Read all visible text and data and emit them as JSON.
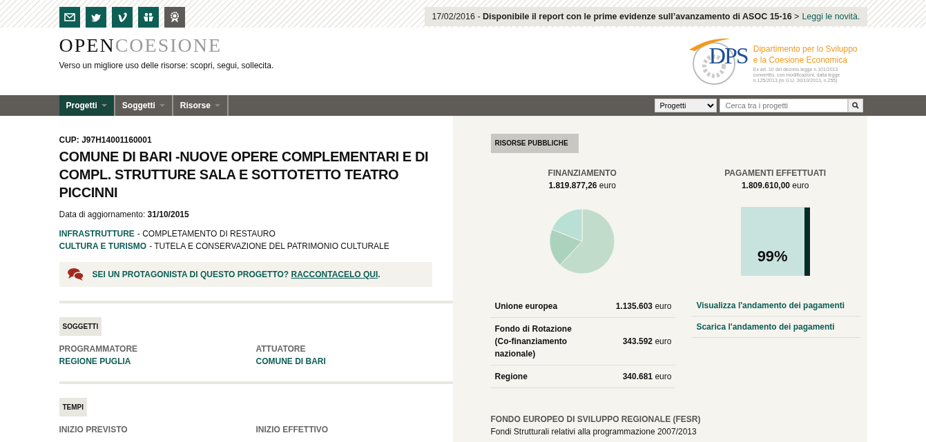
{
  "social_links": [
    {
      "kind": "mail"
    },
    {
      "kind": "bird"
    },
    {
      "kind": "v"
    },
    {
      "kind": "people"
    },
    {
      "kind": "award"
    }
  ],
  "announcement": {
    "text": "17/02/2016 - **Disponibile il report con le prime evidenze sull’avanzamento di ASOC 15-16** >",
    "link": "Leggi le novità."
  },
  "logo": {
    "first": "OPEN",
    "second": "COESIONE",
    "tagline": "Verso un migliore uso delle risorse: scopri, segui, sollecita."
  },
  "department": {
    "acronym": "DPS",
    "name_lines": [
      "Dipartimento  per lo Sviluppo",
      "e la Coesione Economica"
    ],
    "note_lines": [
      "Ex art. 10 del decreto legge n.101/2013",
      "convertito, con modificazioni, dalla legge",
      "n.125/2013 (in G.U. 30/10/2013, n.255)"
    ]
  },
  "nav": {
    "items": [
      {
        "label": "Progetti",
        "selected": true
      },
      {
        "label": "Soggetti",
        "selected": false
      },
      {
        "label": "Risorse",
        "selected": false
      }
    ],
    "scope": "Progetti",
    "search_placeholder": "Cerca tra i progetti"
  },
  "project": {
    "cup": "CUP: J97H14001160001",
    "title": "COMUNE DI BARI -NUOVE OPERE COMPLEMENTARI E DI COMPL. STRUTTURE SALA E SOTTOTETTO TEATRO PICCINNI",
    "updated": "Data di aggiornamento: **31/10/2015**",
    "themes": [
      {
        "name": "INFRASTRUTTURE",
        "detail": "- COMPLETAMENTO DI RESTAURO"
      },
      {
        "name": "CULTURA E TURISMO",
        "detail": "- TUTELA E CONSERVAZIONE DEL PATRIMONIO CULTURALE"
      }
    ],
    "callout": {
      "question": "SEI UN PROTAGONISTA DI QUESTO PROGETTO?",
      "link": "RACCONTACELO QUI",
      "end": "."
    }
  },
  "sections": [
    {
      "heading": "SOGGETTI",
      "fields": [
        {
          "label": "PROGRAMMATORE",
          "value": "REGIONE PUGLIA"
        },
        {
          "label": "ATTUATORE",
          "value": "COMUNE DI BARI"
        }
      ]
    },
    {
      "heading": "TEMPI",
      "fields": [
        {
          "label": "INIZIO PREVISTO"
        },
        {
          "label": "INIZIO EFFETTIVO"
        }
      ]
    }
  ],
  "resources": {
    "heading": "RISORSE PUBBLICHE",
    "financing": {
      "title": "FINANZIAMENTO",
      "amount": "**1.819.877,26** euro"
    },
    "payments": {
      "title": "PAGAMENTI EFFETTUATI",
      "amount": "**1.809.610,00** euro",
      "level": 0.99,
      "percent": "99%"
    },
    "sources": [
      {
        "name": "Unione europea",
        "amount": "**1.135.603** euro"
      },
      {
        "name": "Fondo di Rotazione (Co-finanziamento nazionale)",
        "amount": "**343.592** euro"
      },
      {
        "name": "Regione",
        "amount": "**340.681** euro"
      }
    ],
    "links": [
      "Visualizza l'andamento dei pagamenti",
      "Scarica l'andamento dei pagamenti"
    ],
    "fund": {
      "title": "FONDO EUROPEO DI SVILUPPO REGIONALE (FESR)",
      "subtitle": "Fondi Strutturali relativi alla programmazione 2007/2013"
    }
  }
}
